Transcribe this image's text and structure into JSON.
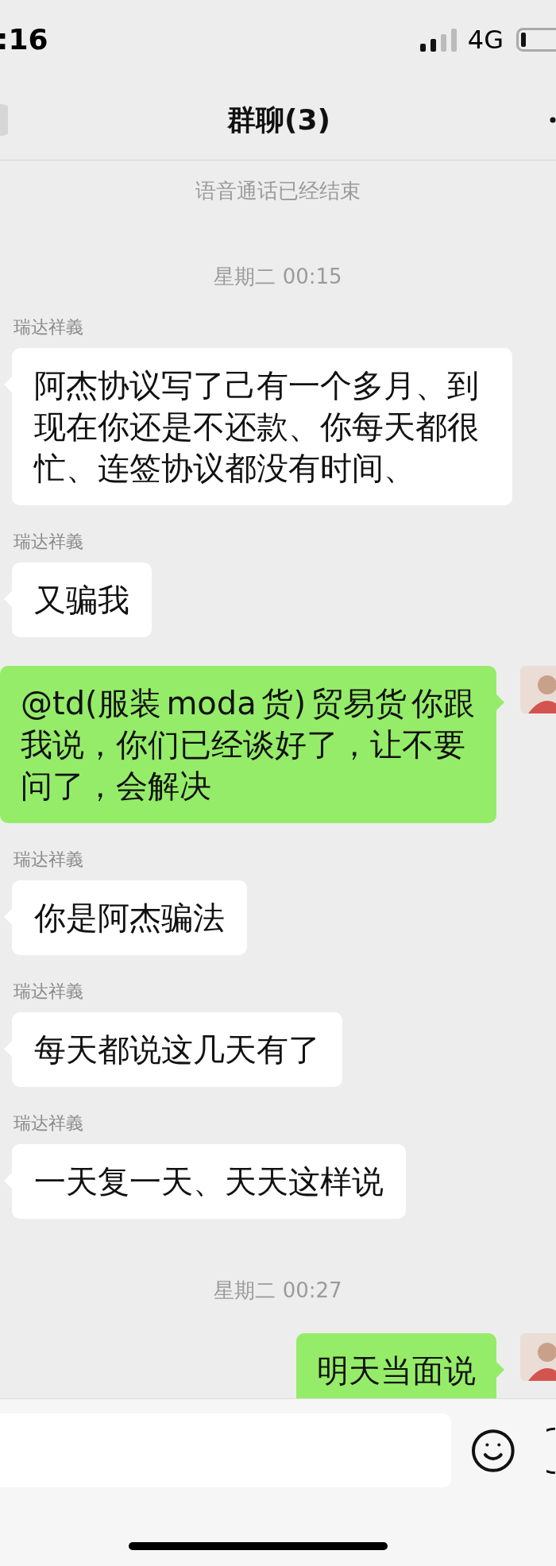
{
  "status_bar": {
    "time": ":16",
    "network": "4G"
  },
  "header": {
    "title": "群聊(3)"
  },
  "messages": [
    {
      "kind": "system",
      "text": "语音通话已经结束"
    },
    {
      "kind": "time",
      "text": "星期二 00:15"
    },
    {
      "kind": "incoming",
      "sender": "瑞达祥義",
      "text": "阿杰协议写了己有一个多月、到现在你还是不还款、你每天都很忙、连签协议都没有时间、"
    },
    {
      "kind": "incoming",
      "sender": "瑞达祥義",
      "text": "又骗我"
    },
    {
      "kind": "outgoing",
      "text": "@td(服装 moda 货) 贸易货 你跟我说，你们已经谈好了，让不要问了，会解决"
    },
    {
      "kind": "incoming",
      "sender": "瑞达祥義",
      "text": "你是阿杰骗法"
    },
    {
      "kind": "incoming",
      "sender": "瑞达祥義",
      "text": "每天都说这几天有了"
    },
    {
      "kind": "incoming",
      "sender": "瑞达祥義",
      "text": "一天复一天、天天这样说"
    },
    {
      "kind": "time",
      "text": "星期二 00:27"
    },
    {
      "kind": "outgoing",
      "text": "明天当面说"
    }
  ]
}
